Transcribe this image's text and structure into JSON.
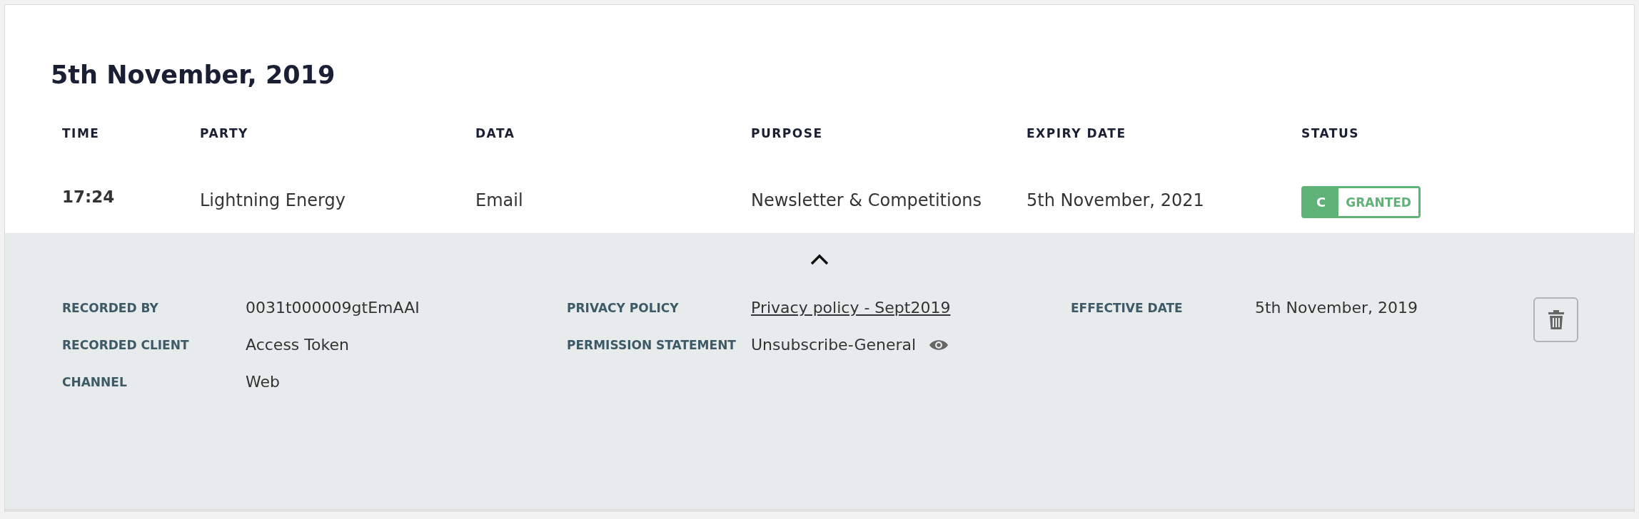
{
  "date_heading": "5th November, 2019",
  "table": {
    "columns": [
      "TIME",
      "PARTY",
      "DATA",
      "PURPOSE",
      "EXPIRY DATE",
      "STATUS"
    ],
    "row": {
      "time": "17:24",
      "party": "Lightning Energy",
      "data": "Email",
      "purpose": "Newsletter & Competitions",
      "expiry_date": "5th November, 2021",
      "status": {
        "code": "C",
        "label": "GRANTED",
        "color": "#5fb278"
      }
    }
  },
  "details": {
    "expanded": true,
    "columns": [
      [
        {
          "label": "RECORDED BY",
          "value": "0031t000009gtEmAAI",
          "kind": "text"
        },
        {
          "label": "RECORDED CLIENT",
          "value": "Access Token",
          "kind": "text"
        },
        {
          "label": "CHANNEL",
          "value": "Web",
          "kind": "text"
        }
      ],
      [
        {
          "label": "PRIVACY POLICY",
          "value": "Privacy policy - Sept2019",
          "kind": "link"
        },
        {
          "label": "PERMISSION STATEMENT",
          "value": "Unsubscribe-General",
          "kind": "viewable"
        }
      ],
      [
        {
          "label": "EFFECTIVE DATE",
          "value": "5th November, 2019",
          "kind": "text"
        }
      ]
    ]
  }
}
